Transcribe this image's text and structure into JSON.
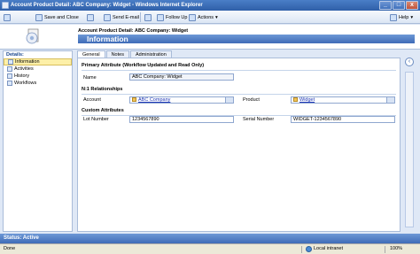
{
  "window": {
    "title": "Account Product Detail: ABC Company: Widget - Windows Internet Explorer",
    "buttons": {
      "minimize": "_",
      "maximize": "□",
      "close": "x"
    }
  },
  "toolbar": {
    "save": "",
    "save_and_close": "Save and Close",
    "print": "",
    "send_email": "Send E-mail",
    "attach": "",
    "follow_up": "Follow Up",
    "actions": "Actions",
    "help": "Help"
  },
  "header": {
    "entity_title": "Account Product Detail: ABC Company: Widget",
    "form_title": "Information"
  },
  "sidebar": {
    "title": "Details:",
    "items": [
      {
        "label": "Information"
      },
      {
        "label": "Activities"
      },
      {
        "label": "History"
      },
      {
        "label": "Workflows"
      }
    ]
  },
  "tabs": [
    "General",
    "Notes",
    "Administration"
  ],
  "form": {
    "section_primary": "Primary Attribute (Workflow Updated and Read Only)",
    "name_label": "Name",
    "name_value": "ABC Company: Widget",
    "section_relationships": "N:1 Relationships",
    "account_label": "Account",
    "account_value": "ABC Company",
    "product_label": "Product",
    "product_value": "Widget",
    "section_custom": "Custom Attributes",
    "lot_label": "Lot Number",
    "lot_value": "1234567890",
    "serial_label": "Serial Number",
    "serial_value": "WIDGET-1234567890"
  },
  "status": {
    "crm": "Status: Active",
    "ie_done": "Done",
    "zone": "Local intranet",
    "zoom": "100%"
  }
}
